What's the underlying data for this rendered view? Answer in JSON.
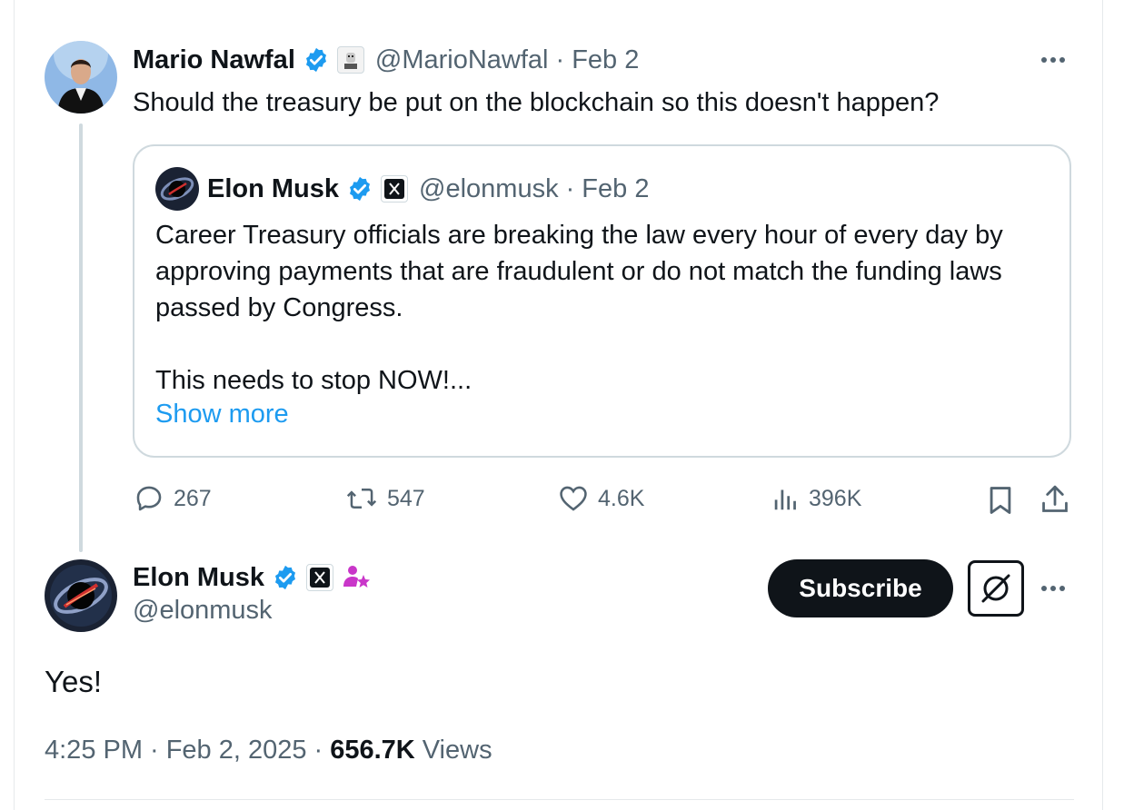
{
  "colors": {
    "accent": "#1d9bf0",
    "verified": "#1d9bf0",
    "text": "#0f1419",
    "muted": "#536471",
    "border": "#cfd9de"
  },
  "parent_tweet": {
    "author_name": "Mario Nawfal",
    "handle": "@MarioNawfal",
    "date": "· Feb 2",
    "text": "Should the treasury be put on the blockchain so this doesn't happen?",
    "quote": {
      "author_name": "Elon Musk",
      "handle": "@elonmusk",
      "date": "· Feb 2",
      "text_line1": "Career Treasury officials are breaking the law every hour of every day by approving payments that are fraudulent or do not match the funding laws passed by Congress.",
      "text_line2": "This needs to stop NOW!...",
      "show_more": "Show more"
    },
    "actions": {
      "replies": "267",
      "reposts": "547",
      "likes": "4.6K",
      "views": "396K"
    }
  },
  "main_tweet": {
    "author_name": "Elon Musk",
    "handle": "@elonmusk",
    "subscribe_label": "Subscribe",
    "text": "Yes!",
    "time": "4:25 PM",
    "date": "· Feb 2, 2025 ·",
    "view_count": "656.7K",
    "views_label": "Views"
  },
  "icons": [
    "verified-badge-icon",
    "affiliate-badge-icon",
    "x-logo-icon",
    "subscriber-star-icon",
    "reply-icon",
    "repost-icon",
    "like-icon",
    "views-icon",
    "bookmark-icon",
    "share-icon",
    "more-icon",
    "grok-icon"
  ]
}
